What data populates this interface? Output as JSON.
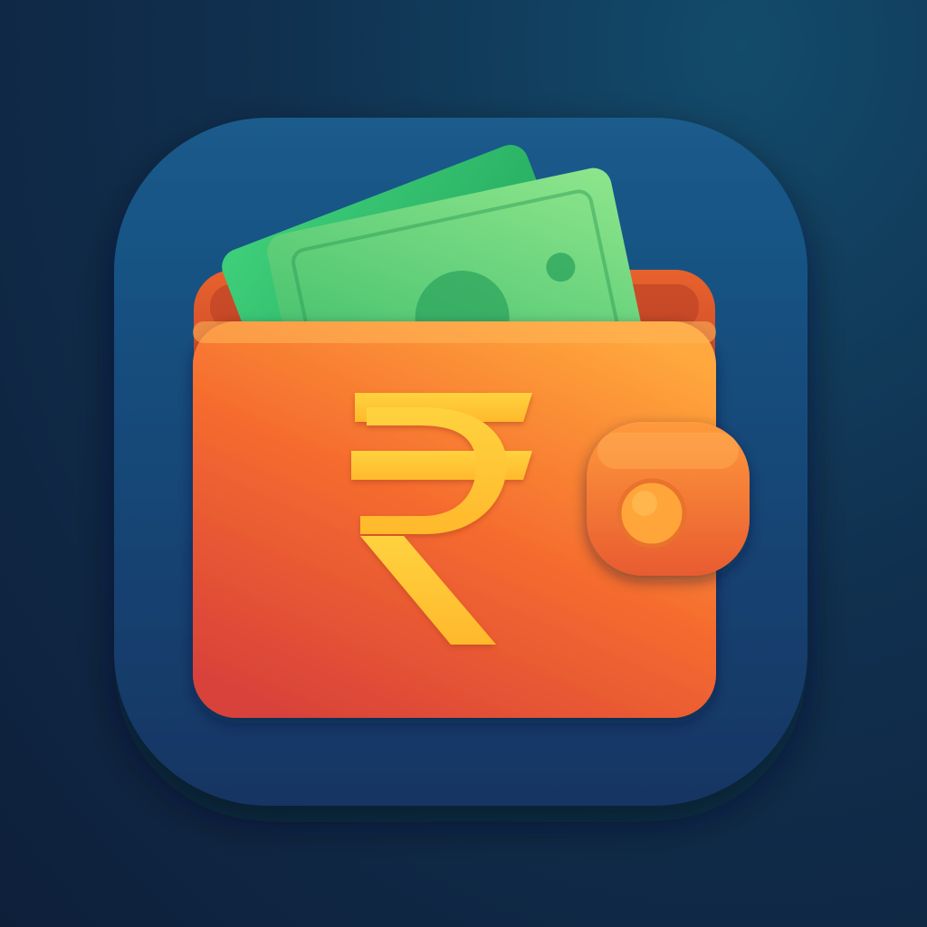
{
  "app_icon": {
    "name": "rupee-wallet-app-icon",
    "symbol": "₹",
    "colors": {
      "background_top": "#134b6b",
      "background_bottom": "#0e1f3a",
      "tile_top": "#1a5b8c",
      "tile_bottom": "#143563",
      "wallet_light": "#ffa83c",
      "wallet_mid": "#f56b2e",
      "wallet_dark": "#d9423a",
      "symbol": "#ffcf3a",
      "cash_light": "#8be08a",
      "cash_dark": "#1fa85a"
    }
  }
}
